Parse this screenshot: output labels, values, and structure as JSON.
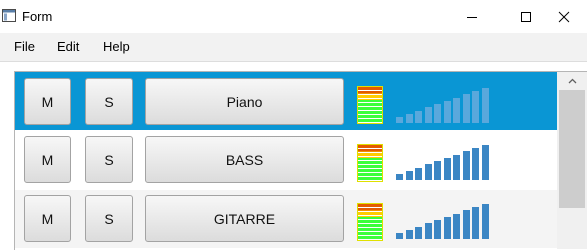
{
  "window": {
    "title": "Form"
  },
  "menu": {
    "items": [
      "File",
      "Edit",
      "Help"
    ]
  },
  "tracks": [
    {
      "mute_label": "M",
      "solo_label": "S",
      "name": "Piano",
      "selected": true,
      "levels": [
        0.15,
        0.23,
        0.31,
        0.39,
        0.47,
        0.55,
        0.63,
        0.72,
        0.8,
        0.88
      ]
    },
    {
      "mute_label": "M",
      "solo_label": "S",
      "name": "BASS",
      "selected": false,
      "levels": [
        0.15,
        0.23,
        0.31,
        0.39,
        0.47,
        0.55,
        0.63,
        0.72,
        0.8,
        0.88
      ]
    },
    {
      "mute_label": "M",
      "solo_label": "S",
      "name": "GITARRE",
      "selected": false,
      "levels": [
        0.15,
        0.23,
        0.31,
        0.39,
        0.47,
        0.55,
        0.63,
        0.72,
        0.8,
        0.88
      ]
    }
  ],
  "colors": {
    "selection": "#0a96d4",
    "bar_default": "#3b86c4",
    "bar_selected": "#5aa8dc",
    "meter_red": "#e35a00",
    "meter_yellow": "#ffcc00",
    "meter_green": "#3aff3a"
  }
}
